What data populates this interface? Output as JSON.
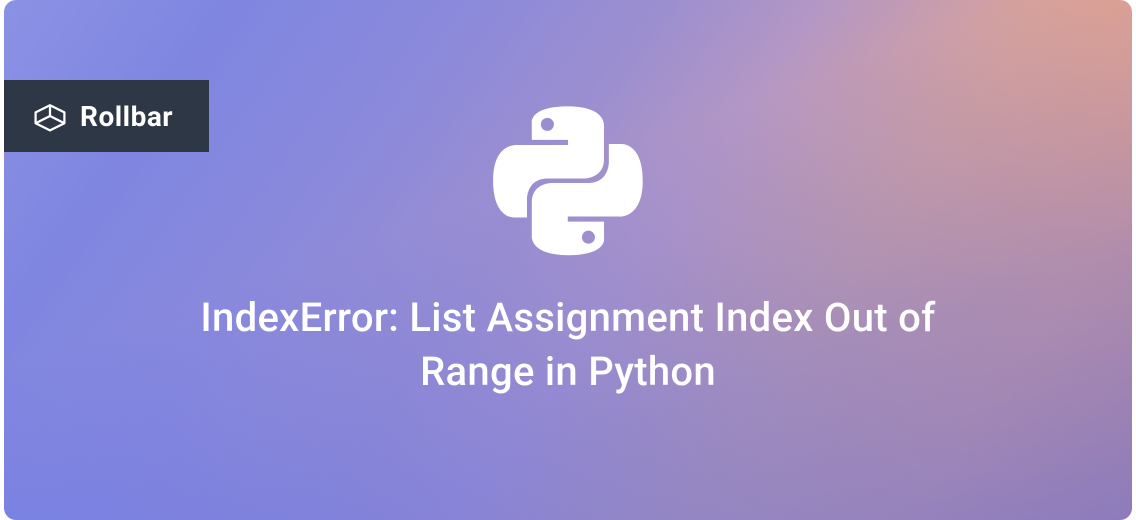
{
  "brand": {
    "name": "Rollbar"
  },
  "headline": "IndexError: List Assignment Index Out of Range in Python",
  "colors": {
    "badge_bg": "#2d3746",
    "text": "#ffffff"
  }
}
